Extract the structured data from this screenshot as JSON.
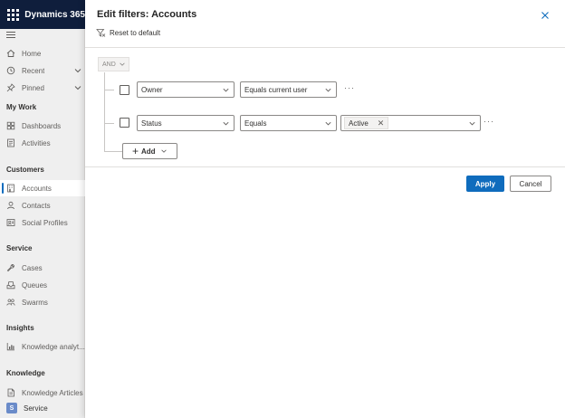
{
  "app": {
    "title": "Dynamics 365"
  },
  "sidebar": {
    "top_items": [
      {
        "label": "Home",
        "icon": "home-icon"
      },
      {
        "label": "Recent",
        "icon": "clock-icon"
      },
      {
        "label": "Pinned",
        "icon": "pin-icon"
      }
    ],
    "sections": [
      {
        "title": "My Work",
        "items": [
          {
            "label": "Dashboards"
          },
          {
            "label": "Activities"
          }
        ]
      },
      {
        "title": "Customers",
        "items": [
          {
            "label": "Accounts",
            "selected": true
          },
          {
            "label": "Contacts"
          },
          {
            "label": "Social Profiles"
          }
        ]
      },
      {
        "title": "Service",
        "items": [
          {
            "label": "Cases"
          },
          {
            "label": "Queues"
          },
          {
            "label": "Swarms"
          }
        ]
      },
      {
        "title": "Insights",
        "items": [
          {
            "label": "Knowledge analyt..."
          }
        ]
      },
      {
        "title": "Knowledge",
        "items": [
          {
            "label": "Knowledge Articles"
          }
        ]
      }
    ],
    "area": {
      "badge": "S",
      "label": "Service"
    }
  },
  "panel": {
    "title": "Edit filters: Accounts",
    "reset_label": "Reset to default",
    "group_operator": "AND",
    "rows": [
      {
        "field": "Owner",
        "operator": "Equals current user"
      },
      {
        "field": "Status",
        "operator": "Equals",
        "value_tag": "Active"
      }
    ],
    "add_label": "Add",
    "apply_label": "Apply",
    "cancel_label": "Cancel"
  },
  "colors": {
    "topbar": "#0f1e3c",
    "primary": "#0f6cbd",
    "sidebar_bg": "#efefef"
  }
}
